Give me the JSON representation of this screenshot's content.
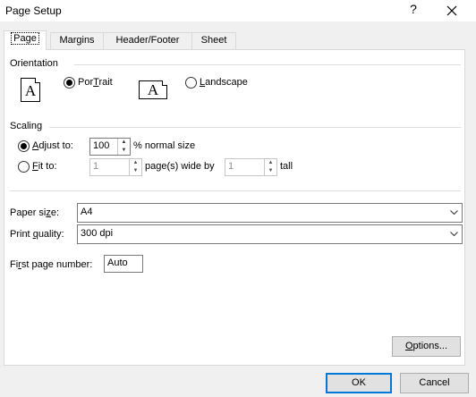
{
  "window": {
    "title": "Page Setup",
    "help": "?"
  },
  "tabs": [
    {
      "label": "Page"
    },
    {
      "label": "Margins"
    },
    {
      "label": "Header/Footer"
    },
    {
      "label": "Sheet"
    }
  ],
  "orientation": {
    "heading": "Orientation",
    "portrait": {
      "label_underlined": "T",
      "label_rest_pre": "Por",
      "label_rest_post": "rait",
      "checked": true
    },
    "landscape": {
      "label_underlined": "L",
      "label_rest_post": "andscape",
      "checked": false
    },
    "icon_letter": "A"
  },
  "scaling": {
    "heading": "Scaling",
    "adjust_to": {
      "underlined": "A",
      "rest": "djust to:",
      "value": "100",
      "suffix": "% normal size",
      "checked": true
    },
    "fit_to": {
      "underlined": "F",
      "rest": "it to:",
      "wide_value": "1",
      "wide_label": "page(s) wide by",
      "tall_value": "1",
      "tall_label": "tall",
      "checked": false
    }
  },
  "paper_size": {
    "pre": "Paper si",
    "underlined": "z",
    "post": "e:",
    "value": "A4"
  },
  "print_quality": {
    "pre": "Print ",
    "underlined": "q",
    "post": "uality:",
    "value": "300 dpi"
  },
  "first_page": {
    "pre": "Fi",
    "underlined": "r",
    "post": "st page number:",
    "value": "Auto"
  },
  "buttons": {
    "options": {
      "underlined": "O",
      "rest": "ptions..."
    },
    "ok": "OK",
    "cancel": "Cancel"
  }
}
